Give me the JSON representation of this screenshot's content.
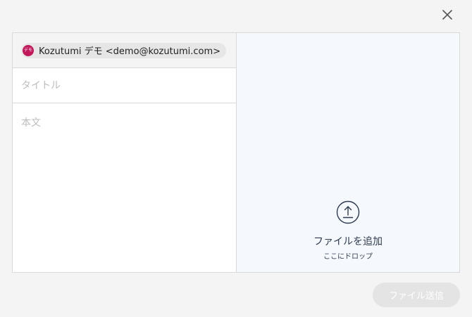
{
  "dialog": {
    "close_icon": "close-icon"
  },
  "recipient": {
    "avatar_text": "デモ",
    "label": "Kozutumi デモ <demo@kozutumi.com>",
    "avatar_color": "#c2185b"
  },
  "form": {
    "title_placeholder": "タイトル",
    "body_placeholder": "本文"
  },
  "dropzone": {
    "icon": "upload-icon",
    "title": "ファイルを追加",
    "subtitle": "ここにドロップ"
  },
  "footer": {
    "send_label": "ファイル送信"
  }
}
